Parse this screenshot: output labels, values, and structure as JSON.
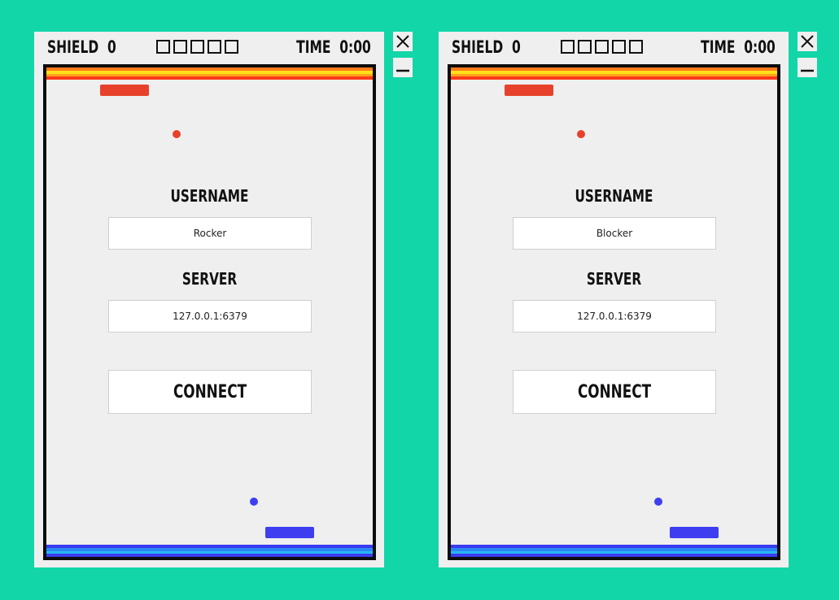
{
  "colors": {
    "background": "#12d6a8",
    "red_player": "#e8412b",
    "blue_player": "#3e3ef0"
  },
  "windows": [
    {
      "hud": {
        "shield_label": "SHIELD",
        "shield_value": "0",
        "lives_boxes": 5,
        "time_label": "TIME",
        "time_value": "0:00"
      },
      "form": {
        "username_label": "USERNAME",
        "username_value": "Rocker",
        "server_label": "SERVER",
        "server_value": "127.0.0.1:6379",
        "connect_label": "CONNECT"
      },
      "controls": {
        "close_icon": "close-icon",
        "minimize_icon": "minimize-icon"
      }
    },
    {
      "hud": {
        "shield_label": "SHIELD",
        "shield_value": "0",
        "lives_boxes": 5,
        "time_label": "TIME",
        "time_value": "0:00"
      },
      "form": {
        "username_label": "USERNAME",
        "username_value": "Blocker",
        "server_label": "SERVER",
        "server_value": "127.0.0.1:6379",
        "connect_label": "CONNECT"
      },
      "controls": {
        "close_icon": "close-icon",
        "minimize_icon": "minimize-icon"
      }
    }
  ]
}
